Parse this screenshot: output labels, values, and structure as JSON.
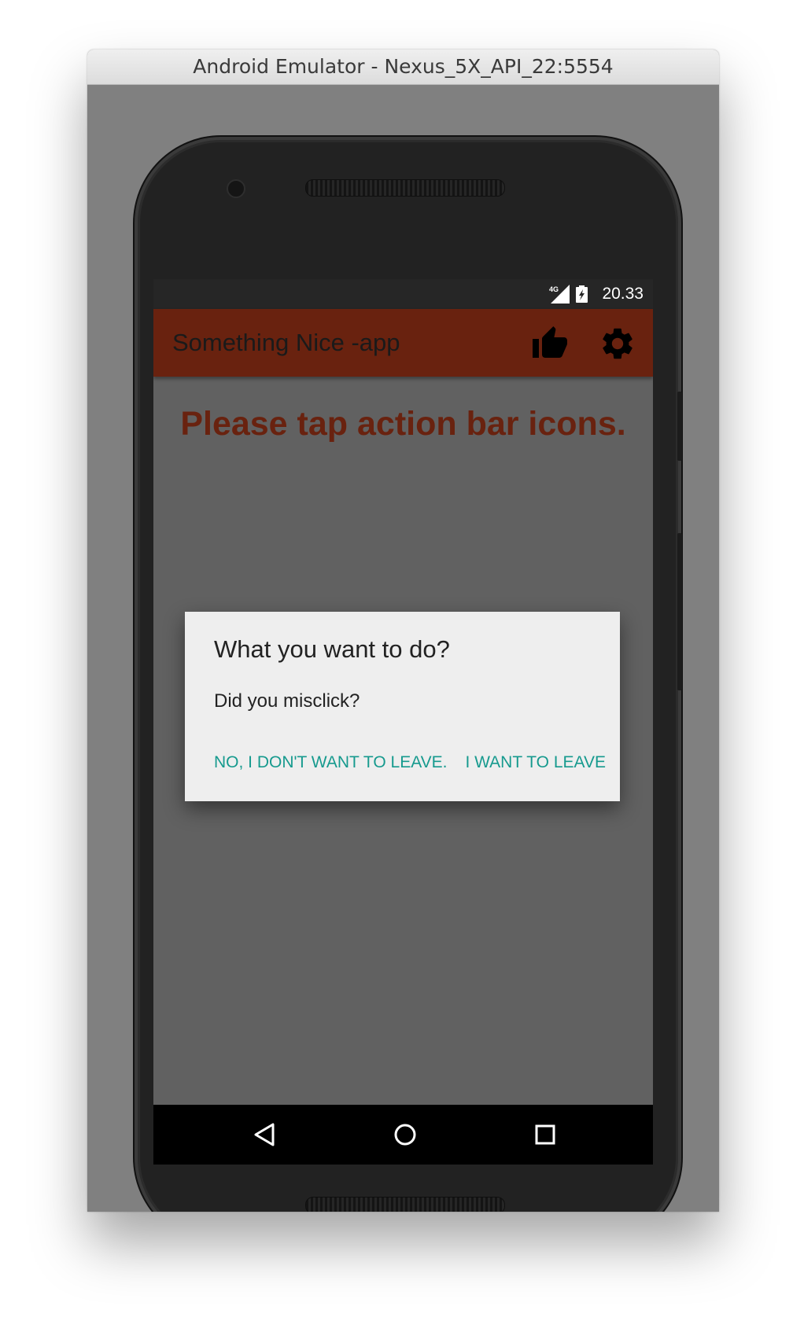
{
  "window": {
    "title": "Android Emulator - Nexus_5X_API_22:5554"
  },
  "statusbar": {
    "network": "4G",
    "time": "20.33",
    "icons": [
      "signal-4g-icon",
      "battery-charging-icon"
    ]
  },
  "appbar": {
    "title": "Something Nice -app",
    "actions": [
      "thumbs-up-icon",
      "settings-gear-icon"
    ],
    "color": "#69220f"
  },
  "main": {
    "message": "Please tap action bar icons."
  },
  "dialog": {
    "title": "What you want to do?",
    "message": "Did you misclick?",
    "negative_button": "NO, I DON'T WANT TO LEAVE.",
    "positive_button": "I WANT TO LEAVE",
    "button_color": "#169a8e"
  },
  "navbar": {
    "buttons": [
      "back-icon",
      "home-icon",
      "recents-icon"
    ]
  }
}
